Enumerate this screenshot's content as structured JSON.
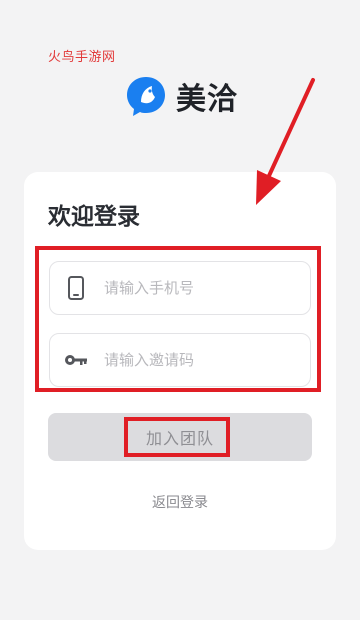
{
  "watermark": "火鸟手游网",
  "brand": {
    "name": "美洽",
    "logo_icon": "chat-bird-logo-icon",
    "logo_color": "#1a7ff0"
  },
  "login": {
    "title": "欢迎登录",
    "phone": {
      "placeholder": "请输入手机号",
      "icon": "phone-icon",
      "value": ""
    },
    "invite": {
      "placeholder": "请输入邀请码",
      "icon": "key-icon",
      "value": ""
    },
    "join_label": "加入团队",
    "back_label": "返回登录"
  },
  "colors": {
    "annotation_red": "#e01e25",
    "button_disabled_bg": "#dcdcdf",
    "watermark_red": "#e23a3a"
  }
}
